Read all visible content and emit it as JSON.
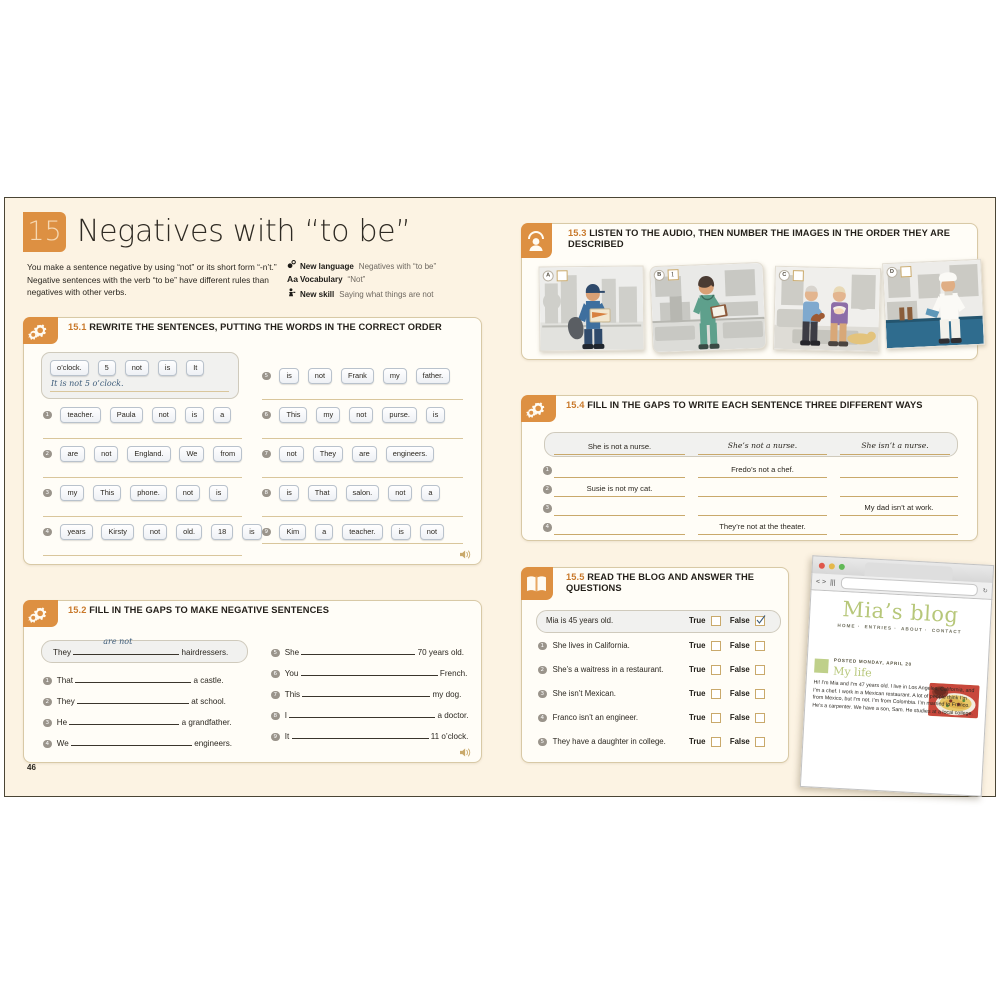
{
  "page": {
    "number": "46"
  },
  "unit": {
    "number": "15",
    "title": "Negatives with “to be”",
    "intro": "You make a sentence negative by using “not” or its short form “-n’t.” Negative sentences with the verb “to be” have different rules than negatives with other verbs.",
    "keys": [
      {
        "icon": "new-language-icon",
        "glyph": "⚭",
        "label": "New language",
        "value": "Negatives with “to be”"
      },
      {
        "icon": "vocabulary-icon",
        "glyph": "Aa",
        "label": "Vocabulary",
        "value": "“Not”"
      },
      {
        "icon": "new-skill-icon",
        "glyph": "♟",
        "label": "New skill",
        "value": "Saying what things are not"
      }
    ]
  },
  "ex151": {
    "number": "15.1",
    "title": "REWRITE THE SENTENCES, PUTTING THE WORDS IN THE CORRECT ORDER",
    "icon": "gear-icon",
    "audio_icon": "speaker-icon",
    "sample": {
      "tiles": [
        "o’clock.",
        "5",
        "not",
        "is",
        "It"
      ],
      "answer": "It is not 5 o’clock."
    },
    "left_items": [
      {
        "num": "1",
        "tiles": [
          "teacher.",
          "Paula",
          "not",
          "is",
          "a"
        ]
      },
      {
        "num": "2",
        "tiles": [
          "are",
          "not",
          "England.",
          "We",
          "from"
        ]
      },
      {
        "num": "3",
        "tiles": [
          "my",
          "This",
          "phone.",
          "not",
          "is"
        ]
      },
      {
        "num": "4",
        "tiles": [
          "years",
          "Kirsty",
          "not",
          "old.",
          "18",
          "is"
        ]
      }
    ],
    "right_items": [
      {
        "num": "5",
        "tiles": [
          "is",
          "not",
          "Frank",
          "my",
          "father."
        ]
      },
      {
        "num": "6",
        "tiles": [
          "This",
          "my",
          "not",
          "purse.",
          "is"
        ]
      },
      {
        "num": "7",
        "tiles": [
          "not",
          "They",
          "are",
          "engineers."
        ]
      },
      {
        "num": "8",
        "tiles": [
          "is",
          "That",
          "salon.",
          "not",
          "a"
        ]
      },
      {
        "num": "9",
        "tiles": [
          "Kim",
          "a",
          "teacher.",
          "is",
          "not"
        ]
      }
    ]
  },
  "ex152": {
    "number": "15.2",
    "title": "FILL IN THE GAPS TO MAKE NEGATIVE SENTENCES",
    "icon": "gear-icon",
    "audio_icon": "speaker-icon",
    "sample": {
      "before": "They",
      "answer": "are not",
      "after": "hairdressers."
    },
    "left_items": [
      {
        "num": "1",
        "before": "That",
        "after": "a castle."
      },
      {
        "num": "2",
        "before": "They",
        "after": "at school."
      },
      {
        "num": "3",
        "before": "He",
        "after": "a grandfather."
      },
      {
        "num": "4",
        "before": "We",
        "after": "engineers."
      }
    ],
    "right_items": [
      {
        "num": "5",
        "before": "She",
        "after": "70 years old."
      },
      {
        "num": "6",
        "before": "You",
        "after": "French."
      },
      {
        "num": "7",
        "before": "This",
        "after": "my dog."
      },
      {
        "num": "8",
        "before": "I",
        "after": "a doctor."
      },
      {
        "num": "9",
        "before": "It",
        "after": "11 o’clock."
      }
    ]
  },
  "ex153": {
    "number": "15.3",
    "title": "LISTEN TO THE AUDIO, THEN NUMBER THE IMAGES IN THE ORDER THEY ARE DESCRIBED",
    "icon": "headphones-icon",
    "photos": [
      {
        "letter": "A",
        "answer": "",
        "scene": "mail-carrier-delivering-package"
      },
      {
        "letter": "B",
        "answer": "1",
        "scene": "nurse-with-clipboard-in-hospital"
      },
      {
        "letter": "C",
        "answer": "",
        "scene": "grandparents-with-baby-and-dog"
      },
      {
        "letter": "D",
        "answer": "",
        "scene": "chef-in-kitchen"
      }
    ]
  },
  "ex154": {
    "number": "15.4",
    "title": "FILL IN THE GAPS TO WRITE EACH SENTENCE THREE DIFFERENT WAYS",
    "icon": "gear-icon",
    "sample": [
      "She is not a nurse.",
      "She’s not a nurse.",
      "She isn’t a nurse."
    ],
    "rows": [
      {
        "num": "1",
        "cells": [
          "",
          "Fredo’s not a chef.",
          ""
        ]
      },
      {
        "num": "2",
        "cells": [
          "Susie is not my cat.",
          "",
          ""
        ]
      },
      {
        "num": "3",
        "cells": [
          "",
          "",
          "My dad isn’t at work."
        ]
      },
      {
        "num": "4",
        "cells": [
          "",
          "They’re not at the theater.",
          ""
        ]
      }
    ]
  },
  "ex155": {
    "number": "15.5",
    "title": "READ THE BLOG AND ANSWER THE QUESTIONS",
    "icon": "book-icon",
    "true_label": "True",
    "false_label": "False",
    "sample": {
      "text": "Mia is 45 years old.",
      "checked": "False"
    },
    "items": [
      {
        "num": "1",
        "text": "She lives in California."
      },
      {
        "num": "2",
        "text": "She’s a waitress in a restaurant."
      },
      {
        "num": "3",
        "text": "She isn’t Mexican."
      },
      {
        "num": "4",
        "text": "Franco isn’t an engineer."
      },
      {
        "num": "5",
        "text": "They have a daughter in college."
      }
    ]
  },
  "blog": {
    "title": "Mia’s blog",
    "nav": [
      "HOME",
      "ENTRIES",
      "ABOUT",
      "CONTACT"
    ],
    "posted": "POSTED MONDAY, APRIL 20",
    "heading": "My life",
    "body": "Hi! I’m Mia and I’m 47 years old. I live in Los Angeles, California, and I’m a chef. I work in a Mexican restaurant. A lot of people think I’m from Mexico, but I’m not. I’m from Colombia. I’m married to Franco. He’s a carpenter. We have a son, Sam. He studies at a local college.",
    "image": "plate-of-mexican-food"
  },
  "colors": {
    "accent_orange": "#DD9042",
    "num_orange": "#C9792B",
    "page_cream": "#FCF3E3",
    "panel_cream": "#FFFDF7",
    "rule_tan": "#C9A96B",
    "handwriting_blue": "#3D5C7A",
    "blog_green": "#B7C77A"
  }
}
